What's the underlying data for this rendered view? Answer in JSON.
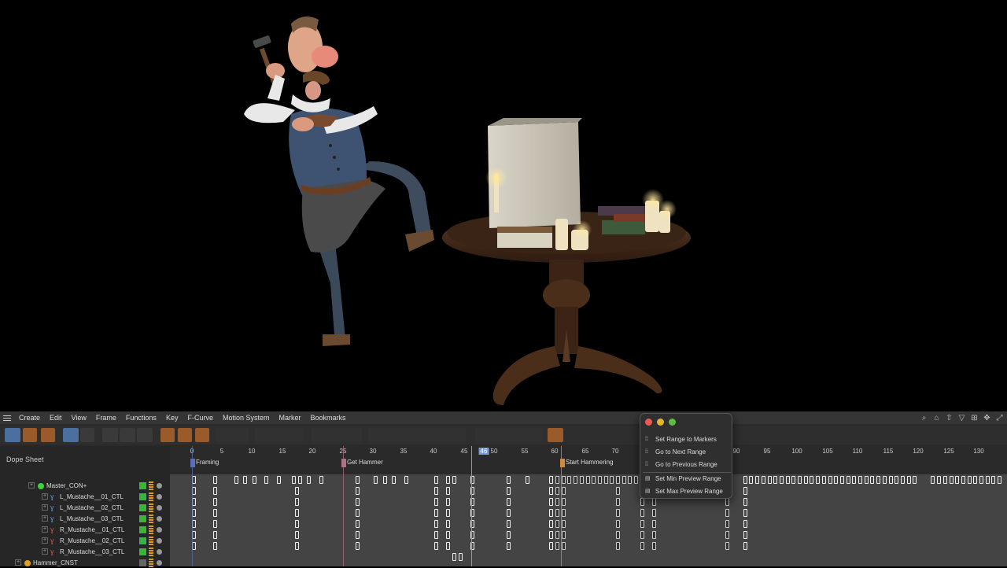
{
  "menubar": {
    "items": [
      "Create",
      "Edit",
      "View",
      "Frame",
      "Functions",
      "Key",
      "F-Curve",
      "Motion System",
      "Marker",
      "Bookmarks"
    ]
  },
  "left_panel": {
    "title": "Dope Sheet",
    "tracks": [
      {
        "label": "Master_CON+",
        "icon": "green-dot"
      },
      {
        "label": "L_Mustache__01_CTL",
        "icon": "blue-ctl-icon"
      },
      {
        "label": "L_Mustache__02_CTL",
        "icon": "blue-ctl-icon"
      },
      {
        "label": "L_Mustache__03_CTL",
        "icon": "blue-ctl-icon"
      },
      {
        "label": "R_Mustache__01_CTL",
        "icon": "red-ctl-icon"
      },
      {
        "label": "R_Mustache__02_CTL",
        "icon": "red-ctl-icon"
      },
      {
        "label": "R_Mustache__03_CTL",
        "icon": "red-ctl-icon"
      },
      {
        "label": "Hammer_CNST",
        "icon": "orange-dot"
      }
    ]
  },
  "ruler": {
    "ticks": [
      "0",
      "5",
      "10",
      "15",
      "20",
      "25",
      "30",
      "35",
      "40",
      "45",
      "46",
      "50",
      "55",
      "60",
      "65",
      "70",
      "90",
      "95",
      "100",
      "105",
      "110",
      "115",
      "120",
      "125",
      "130"
    ],
    "current_frame": "46"
  },
  "markers": [
    {
      "label": "Framing",
      "color": "#5a6fb5"
    },
    {
      "label": "Get Hammer",
      "color": "#b0708a"
    },
    {
      "label": "Start Hammering",
      "color": "#d08a3a"
    }
  ],
  "popup": {
    "items": [
      {
        "label": "Set Range to Markers",
        "icon": "range-markers-icon"
      },
      {
        "label": "Go to Next Range",
        "icon": "next-range-icon"
      },
      {
        "label": "Go to Previous Range",
        "icon": "prev-range-icon"
      },
      {
        "label": "Set Min Preview Range",
        "icon": "min-preview-icon"
      },
      {
        "label": "Set Max Preview Range",
        "icon": "max-preview-icon"
      }
    ]
  },
  "colors": {
    "accent": "#4b6f9e",
    "playhead": "#7c9bd6",
    "marker_framing": "#5a6fb5",
    "marker_get_hammer": "#b0708a",
    "marker_start_hammering": "#d08a3a"
  }
}
